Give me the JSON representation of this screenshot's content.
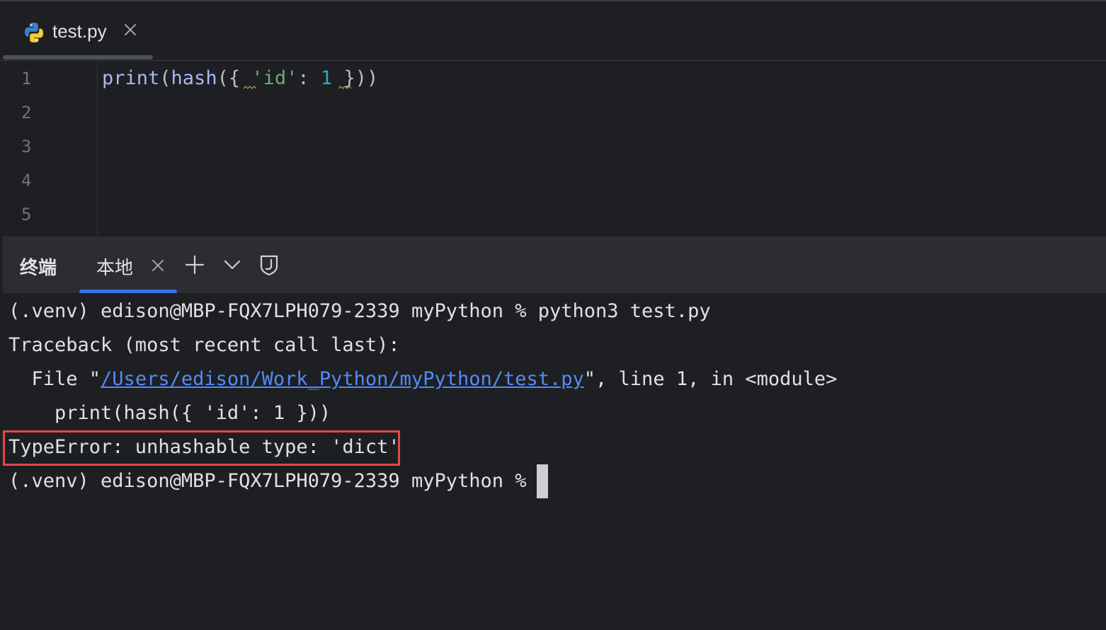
{
  "editor_tab": {
    "filename": "test.py",
    "icon": "python-icon",
    "close_icon": "close-icon"
  },
  "editor": {
    "line_numbers": [
      "1",
      "2",
      "3",
      "4",
      "5"
    ],
    "code": {
      "fn_print": "print",
      "open1": "(",
      "fn_hash": "hash",
      "open2": "({",
      "space1": " ",
      "str_id": "'id'",
      "colon": ": ",
      "num": "1",
      "space2": " ",
      "close": "}))"
    }
  },
  "terminal": {
    "title": "终端",
    "tab_label": "本地",
    "icons": {
      "close": "close-icon",
      "add": "plus-icon",
      "dropdown": "chevron-down-icon",
      "shield": "shield-j-icon"
    },
    "lines": {
      "cmd": "(.venv) edison@MBP-FQX7LPH079-2339 myPython % python3 test.py",
      "traceback": "Traceback (most recent call last):",
      "file_prefix": "  File \"",
      "file_path": "/Users/edison/Work_Python/myPython/test.py",
      "file_suffix": "\", line 1, in <module>",
      "code_echo": "    print(hash({ 'id': 1 }))",
      "error": "TypeError: unhashable type: 'dict'",
      "prompt": "(.venv) edison@MBP-FQX7LPH079-2339 myPython %"
    },
    "colors": {
      "link": "#548af7",
      "error_highlight": "#e24848",
      "accent": "#3574f0"
    }
  }
}
